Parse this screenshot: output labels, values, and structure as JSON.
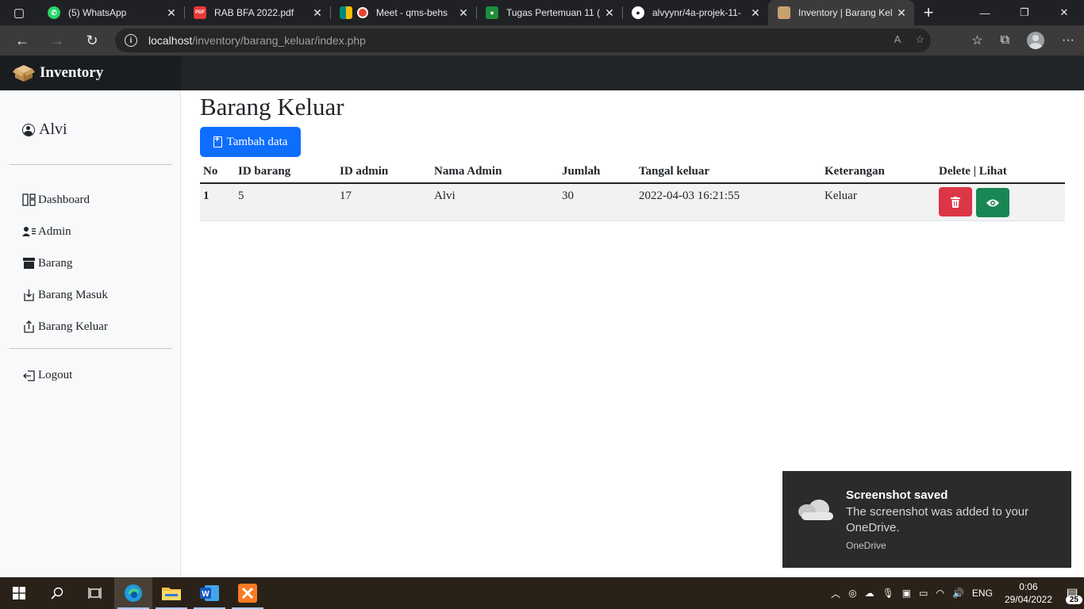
{
  "browser": {
    "tabs": [
      {
        "title": "(5) WhatsApp",
        "icon": "whatsapp-icon",
        "color": "#25d366"
      },
      {
        "title": "RAB BFA 2022.pdf",
        "icon": "pdf-icon",
        "color": "#e53935"
      },
      {
        "title": "Meet - qms-behs",
        "icon": "meet-icon",
        "color": "#00897b"
      },
      {
        "title": "Tugas Pertemuan 11 (",
        "icon": "classroom-icon",
        "color": "#1e8e3e"
      },
      {
        "title": "alvyynr/4a-projek-11-",
        "icon": "github-icon",
        "color": "#ffffff"
      },
      {
        "title": "Inventory | Barang Kel",
        "icon": "box-icon",
        "color": "#c8a26b"
      }
    ],
    "url_host": "localhost",
    "url_path": "/inventory/barang_keluar/index.php"
  },
  "app": {
    "brand": "Inventory",
    "user": "Alvi",
    "menu": [
      "Dashboard",
      "Admin",
      "Barang",
      "Barang Masuk",
      "Barang Keluar"
    ],
    "logout": "Logout"
  },
  "page": {
    "title": "Barang Keluar",
    "add_button": "Tambah data",
    "columns": [
      "No",
      "ID barang",
      "ID admin",
      "Nama Admin",
      "Jumlah",
      "Tangal keluar",
      "Keterangan",
      "Delete | Lihat"
    ],
    "rows": [
      {
        "no": "1",
        "id_barang": "5",
        "id_admin": "17",
        "nama_admin": "Alvi",
        "jumlah": "30",
        "tanggal": "2022-04-03 16:21:55",
        "keterangan": "Keluar"
      }
    ]
  },
  "toast": {
    "title": "Screenshot saved",
    "body": "The screenshot was added to your OneDrive.",
    "source": "OneDrive"
  },
  "taskbar": {
    "language": "ENG",
    "time": "0:06",
    "date": "29/04/2022",
    "notification_count": "25"
  },
  "colors": {
    "primary": "#0d6efd",
    "danger": "#dc3545",
    "success": "#198754",
    "navbar": "#212529"
  }
}
